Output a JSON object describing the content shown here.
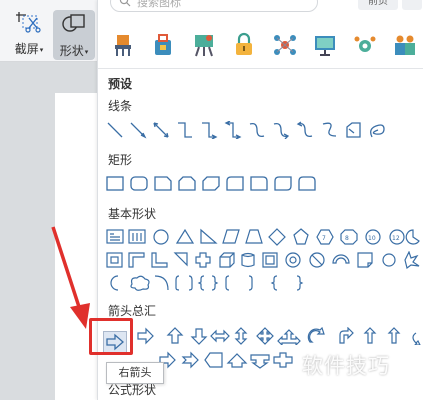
{
  "toolbar": {
    "screenshot_label": "截屏",
    "shapes_label": "形状"
  },
  "panel": {
    "search_placeholder": "搜索图标",
    "prev_label": "前页",
    "recommended_title": "预设",
    "sections": {
      "lines": "线条",
      "rectangles": "矩形",
      "basic_shapes": "基本形状",
      "arrows": "箭头总汇",
      "equation": "公式形状"
    },
    "icon_names": [
      "chair-icon",
      "bag-icon",
      "easel-icon",
      "lock-icon",
      "network-icon",
      "monitor-icon",
      "gear-share-icon",
      "people-icon"
    ],
    "tooltip": "右箭头"
  },
  "colors": {
    "shape_stroke": "#3a6ea5",
    "highlight_red": "#e0302c",
    "selected_bg": "#dde6f2"
  },
  "watermark": "软件技巧"
}
